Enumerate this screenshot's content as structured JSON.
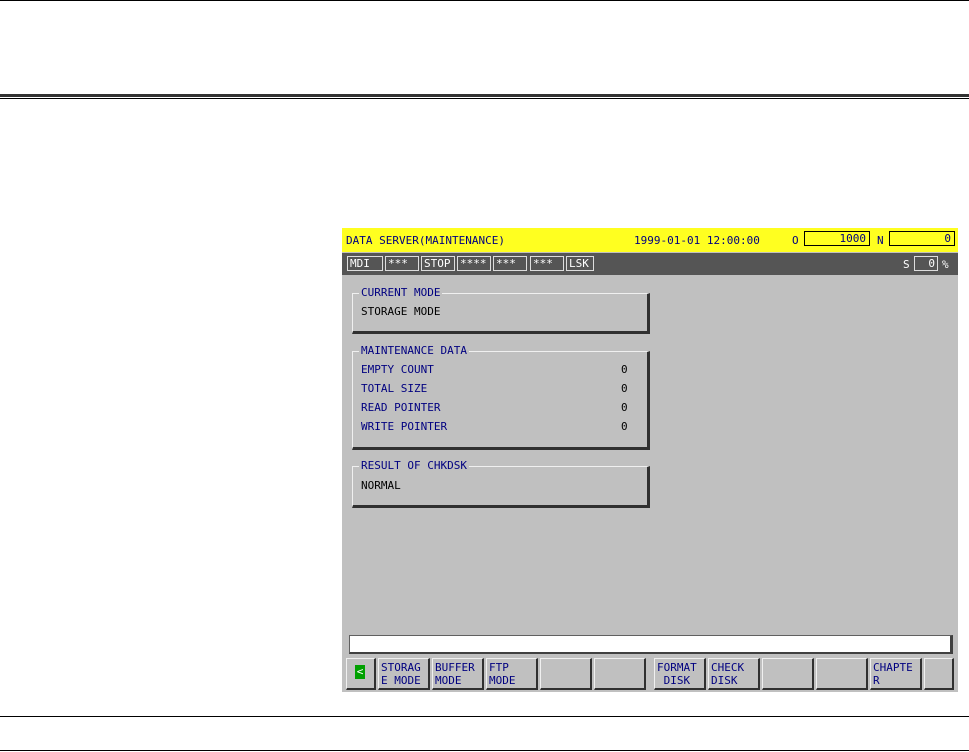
{
  "screen": {
    "title": "DATA SERVER(MAINTENANCE)",
    "datetime": "1999-01-01 12:00:00",
    "o_label": "O",
    "o_value": "1000",
    "n_label": "N",
    "n_value": "0"
  },
  "status": {
    "items": [
      "MDI",
      "***",
      "STOP",
      "****",
      "***",
      "***",
      "LSK"
    ],
    "s_label": "S",
    "s_value": "0",
    "s_unit": "%"
  },
  "current_mode": {
    "label": "CURRENT MODE",
    "value": "STORAGE MODE"
  },
  "maintenance": {
    "label": "MAINTENANCE DATA",
    "rows": [
      {
        "label": "EMPTY COUNT",
        "value": "0"
      },
      {
        "label": "TOTAL SIZE",
        "value": "0"
      },
      {
        "label": "READ POINTER",
        "value": "0"
      },
      {
        "label": "WRITE POINTER",
        "value": "0"
      }
    ]
  },
  "chkdsk": {
    "label": "RESULT OF CHKDSK",
    "value": "NORMAL"
  },
  "softkeys": {
    "left_arrow": "<",
    "keys": [
      "STORAG\nE MODE",
      "BUFFER\nMODE",
      "FTP\nMODE",
      "",
      "",
      "FORMAT\n DISK",
      "CHECK\nDISK",
      "",
      "",
      "CHAPTE\nR"
    ]
  }
}
